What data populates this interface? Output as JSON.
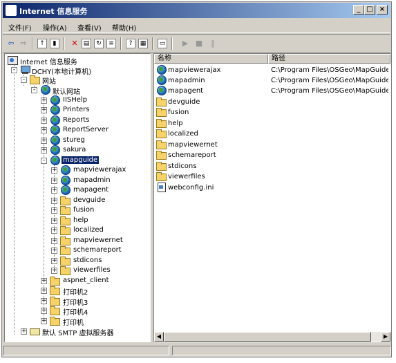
{
  "window": {
    "title": "Internet 信息服务"
  },
  "title_buttons": {
    "minimize": "_",
    "maximize": "□",
    "close": "×"
  },
  "menu": [
    {
      "label": "文件(F)"
    },
    {
      "label": "操作(A)"
    },
    {
      "label": "查看(V)"
    },
    {
      "label": "帮助(H)"
    }
  ],
  "tree": [
    {
      "label": "Internet 信息服务",
      "icon": "iis-icon",
      "expander": ""
    },
    {
      "label": "DCHY(本地计算机)",
      "icon": "computer-icon",
      "expander": "-"
    },
    {
      "label": "网站",
      "icon": "folder-icon",
      "expander": "-"
    },
    {
      "label": "默认网站",
      "icon": "globe-icon",
      "expander": "-"
    },
    {
      "label": "IISHelp",
      "icon": "globe-icon",
      "expander": "+"
    },
    {
      "label": "Printers",
      "icon": "globe-icon",
      "expander": "+"
    },
    {
      "label": "Reports",
      "icon": "globe-icon",
      "expander": "+"
    },
    {
      "label": "ReportServer",
      "icon": "globe-icon",
      "expander": "+"
    },
    {
      "label": "stureg",
      "icon": "globe-icon",
      "expander": "+"
    },
    {
      "label": "sakura",
      "icon": "globe-icon",
      "expander": "+"
    },
    {
      "label": "mapguide",
      "icon": "globe-icon",
      "expander": "-",
      "selected": true
    },
    {
      "label": "mapviewerajax",
      "icon": "globe-icon",
      "expander": "+"
    },
    {
      "label": "mapadmin",
      "icon": "globe-icon",
      "expander": "+"
    },
    {
      "label": "mapagent",
      "icon": "globe-icon",
      "expander": "+"
    },
    {
      "label": "devguide",
      "icon": "folder-icon",
      "expander": "+"
    },
    {
      "label": "fusion",
      "icon": "folder-icon",
      "expander": "+"
    },
    {
      "label": "help",
      "icon": "folder-icon",
      "expander": "+"
    },
    {
      "label": "localized",
      "icon": "folder-icon",
      "expander": "+"
    },
    {
      "label": "mapviewernet",
      "icon": "folder-icon",
      "expander": "+"
    },
    {
      "label": "schemareport",
      "icon": "folder-icon",
      "expander": "+"
    },
    {
      "label": "stdicons",
      "icon": "folder-icon",
      "expander": "+"
    },
    {
      "label": "viewerfiles",
      "icon": "folder-icon",
      "expander": "+"
    },
    {
      "label": "aspnet_client",
      "icon": "folder-icon",
      "expander": "+"
    },
    {
      "label": "打印机2",
      "icon": "folder-icon",
      "expander": "+"
    },
    {
      "label": "打印机3",
      "icon": "folder-icon",
      "expander": "+"
    },
    {
      "label": "打印机4",
      "icon": "folder-icon",
      "expander": "+"
    },
    {
      "label": "打印机",
      "icon": "folder-icon",
      "expander": "+"
    },
    {
      "label": "默认 SMTP 虚拟服务器",
      "icon": "smtp-icon",
      "expander": "+"
    }
  ],
  "list": {
    "columns": {
      "name": "名称",
      "path": "路径"
    },
    "rows": [
      {
        "name": "mapviewerajax",
        "path": "C:\\Program Files\\OSGeo\\MapGuide\\...",
        "icon": "globe-icon"
      },
      {
        "name": "mapadmin",
        "path": "C:\\Program Files\\OSGeo\\MapGuide\\...",
        "icon": "globe-icon"
      },
      {
        "name": "mapagent",
        "path": "C:\\Program Files\\OSGeo\\MapGuide\\...",
        "icon": "globe-icon"
      },
      {
        "name": "devguide",
        "path": "",
        "icon": "folder-icon"
      },
      {
        "name": "fusion",
        "path": "",
        "icon": "folder-icon"
      },
      {
        "name": "help",
        "path": "",
        "icon": "folder-icon"
      },
      {
        "name": "localized",
        "path": "",
        "icon": "folder-icon"
      },
      {
        "name": "mapviewernet",
        "path": "",
        "icon": "folder-icon"
      },
      {
        "name": "schemareport",
        "path": "",
        "icon": "folder-icon"
      },
      {
        "name": "stdicons",
        "path": "",
        "icon": "folder-icon"
      },
      {
        "name": "viewerfiles",
        "path": "",
        "icon": "folder-icon"
      },
      {
        "name": "webconfig.ini",
        "path": "",
        "icon": "file-icon"
      }
    ]
  },
  "colors": {
    "title_start": "#0a246a",
    "title_end": "#a6caf0",
    "selection": "#0a246a",
    "face": "#d4d0c8"
  }
}
